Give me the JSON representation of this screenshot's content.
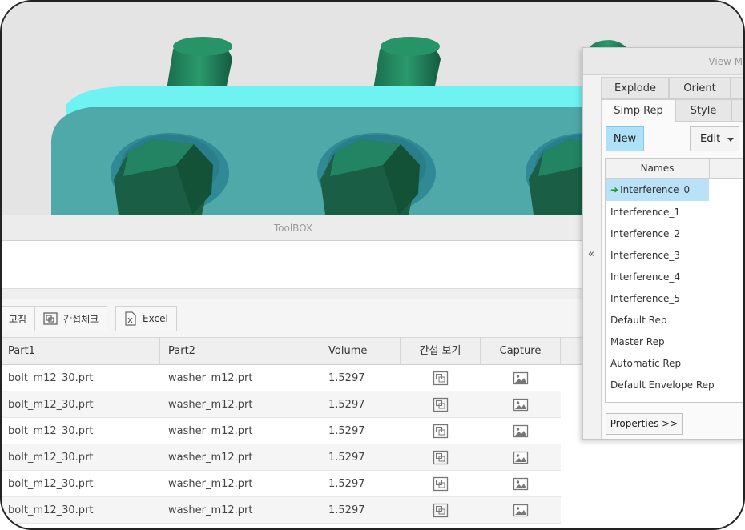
{
  "toolbox": {
    "title": "ToolBOX",
    "buttons": [
      {
        "label": "고침",
        "icon": "repair-icon"
      },
      {
        "label": "간섭체크",
        "icon": "interference-check-icon"
      },
      {
        "label": "Excel",
        "icon": "excel-file-icon"
      }
    ]
  },
  "table": {
    "headers": {
      "part1": "Part1",
      "part2": "Part2",
      "volume": "Volume",
      "view": "간섭 보기",
      "capture": "Capture"
    },
    "rows": [
      {
        "part1": "bolt_m12_30.prt",
        "part2": "washer_m12.prt",
        "volume": "1.5297"
      },
      {
        "part1": "bolt_m12_30.prt",
        "part2": "washer_m12.prt",
        "volume": "1.5297"
      },
      {
        "part1": "bolt_m12_30.prt",
        "part2": "washer_m12.prt",
        "volume": "1.5297"
      },
      {
        "part1": "bolt_m12_30.prt",
        "part2": "washer_m12.prt",
        "volume": "1.5297"
      },
      {
        "part1": "bolt_m12_30.prt",
        "part2": "washer_m12.prt",
        "volume": "1.5297"
      },
      {
        "part1": "bolt_m12_30.prt",
        "part2": "washer_m12.prt",
        "volume": "1.5297"
      }
    ]
  },
  "view_manager": {
    "title": "View Manag",
    "collapse": "«",
    "tabs_top": [
      "Explode",
      "Orient"
    ],
    "tabs_bottom": [
      "Simp Rep",
      "Style"
    ],
    "active_tab": "Simp Rep",
    "new_label": "New",
    "edit_label": "Edit",
    "names_header": "Names",
    "names": [
      "Interference_0",
      "Interference_1",
      "Interference_2",
      "Interference_3",
      "Interference_4",
      "Interference_5",
      "Default Rep",
      "Master Rep",
      "Automatic Rep",
      "Default Envelope Rep"
    ],
    "selected_name": "Interference_0",
    "properties_label": "Properties >>"
  },
  "colors": {
    "plate_face": "#4fa9a8",
    "plate_top": "#6ff2f2",
    "bolt_green": "#1e7d5a",
    "washer_teal": "#2f8a96",
    "selection_blue": "#b9e1f7"
  }
}
